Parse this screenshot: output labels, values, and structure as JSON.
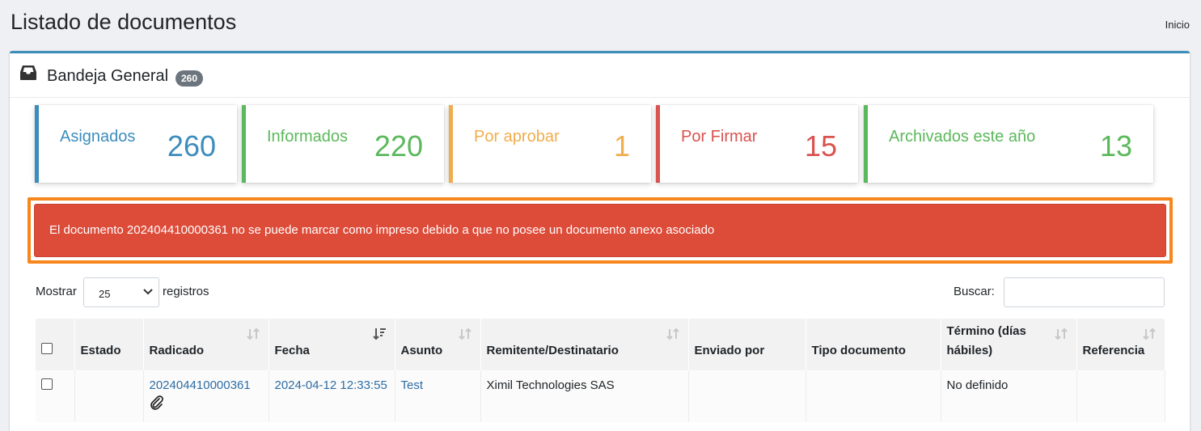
{
  "page": {
    "title": "Listado de documentos",
    "breadcrumb": "Inicio"
  },
  "card": {
    "title": "Bandeja General",
    "badge": "260",
    "icon": "inbox-icon"
  },
  "stats": [
    {
      "label": "Asignados",
      "value": "260",
      "color": "#3c8dbc"
    },
    {
      "label": "Informados",
      "value": "220",
      "color": "#5cb85c"
    },
    {
      "label": "Por aprobar",
      "value": "1",
      "color": "#f0ad4e"
    },
    {
      "label": "Por Firmar",
      "value": "15",
      "color": "#d9534f"
    },
    {
      "label": "Archivados este año",
      "value": "13",
      "color": "#5cb85c"
    }
  ],
  "alert": {
    "message": "El documento 202404410000361 no se puede marcar como impreso debido a que no posee un documento anexo asociado",
    "color": "#dd4b39",
    "highlight_color": "#f7861c"
  },
  "controls": {
    "show_label": "Mostrar",
    "length_value": "25",
    "length_suffix": "registros",
    "search_label": "Buscar:",
    "search_value": ""
  },
  "table": {
    "columns": [
      "",
      "Estado",
      "Radicado",
      "Fecha",
      "Asunto",
      "Remitente/Destinatario",
      "Enviado por",
      "Tipo documento",
      "Término (días hábiles)",
      "Referencia"
    ],
    "rows": [
      {
        "estado": "",
        "radicado": "202404410000361",
        "fecha": "2024-04-12 12:33:55",
        "asunto": "Test",
        "remitente": "Ximil Technologies SAS",
        "enviado_por": "",
        "tipo_documento": "",
        "termino": "No definido",
        "referencia": "",
        "attachment_icon": "paperclip-icon"
      }
    ]
  }
}
